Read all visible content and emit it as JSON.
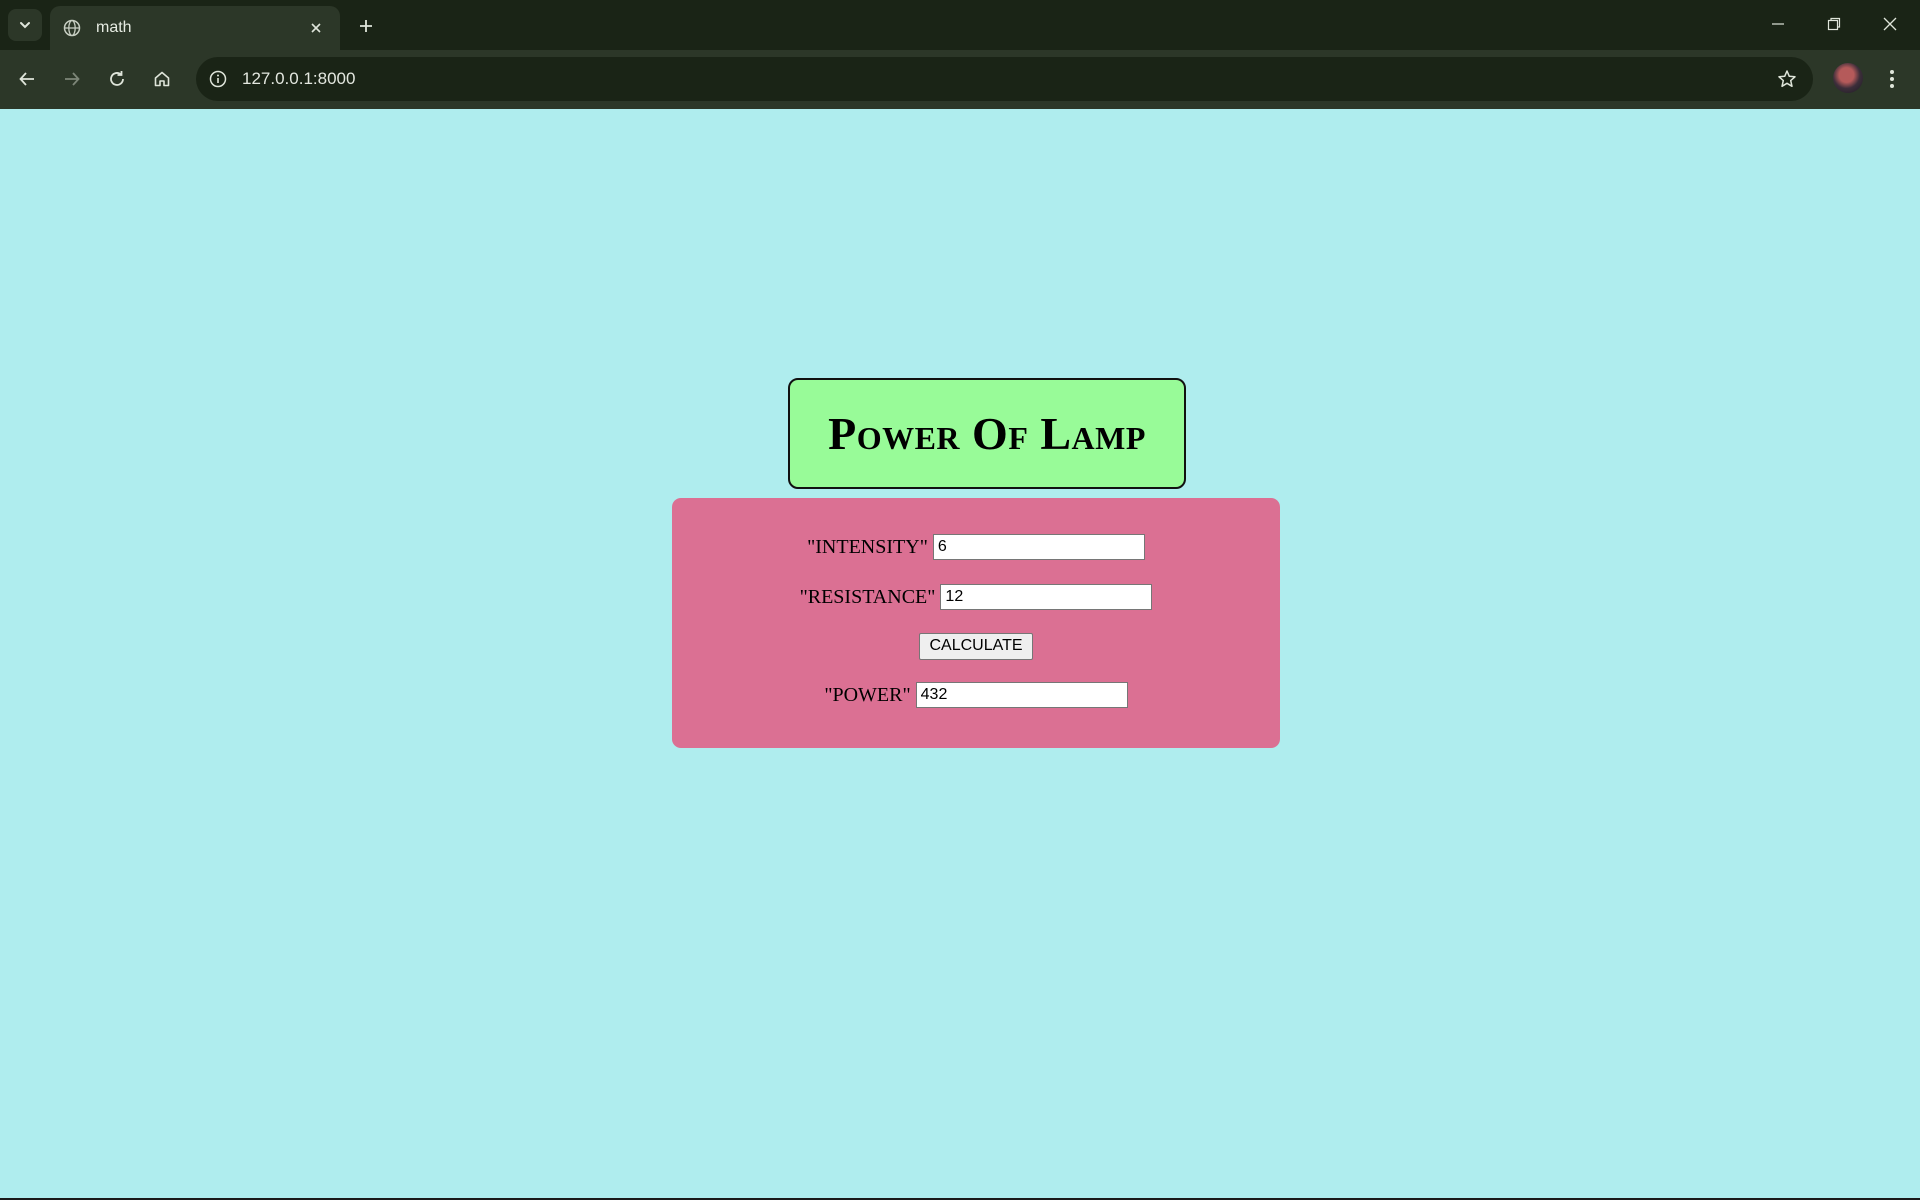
{
  "browser": {
    "tab": {
      "title": "math",
      "favicon": "globe-icon"
    },
    "address_bar": {
      "url": "127.0.0.1:8000"
    },
    "icons": {
      "tab_search": "chevron-down-icon",
      "new_tab": "plus-icon",
      "back": "arrow-left-icon",
      "forward": "arrow-right-icon",
      "reload": "reload-icon",
      "home": "home-icon",
      "site_info": "info-icon",
      "bookmark": "star-icon",
      "menu": "kebab-menu-icon",
      "minimize": "minimize-icon",
      "restore": "restore-icon",
      "close": "close-icon"
    }
  },
  "page": {
    "title": "Power Of Lamp",
    "form": {
      "intensity": {
        "label": "\"INTENSITY\"",
        "value": "6"
      },
      "resistance": {
        "label": "\"RESISTANCE\"",
        "value": "12"
      },
      "calculate_label": "CALCULATE",
      "power": {
        "label": "\"POWER\"",
        "value": "432"
      }
    },
    "colors": {
      "background": "#afedee",
      "title_box": "#98fb98",
      "form_box": "#db7093"
    }
  }
}
